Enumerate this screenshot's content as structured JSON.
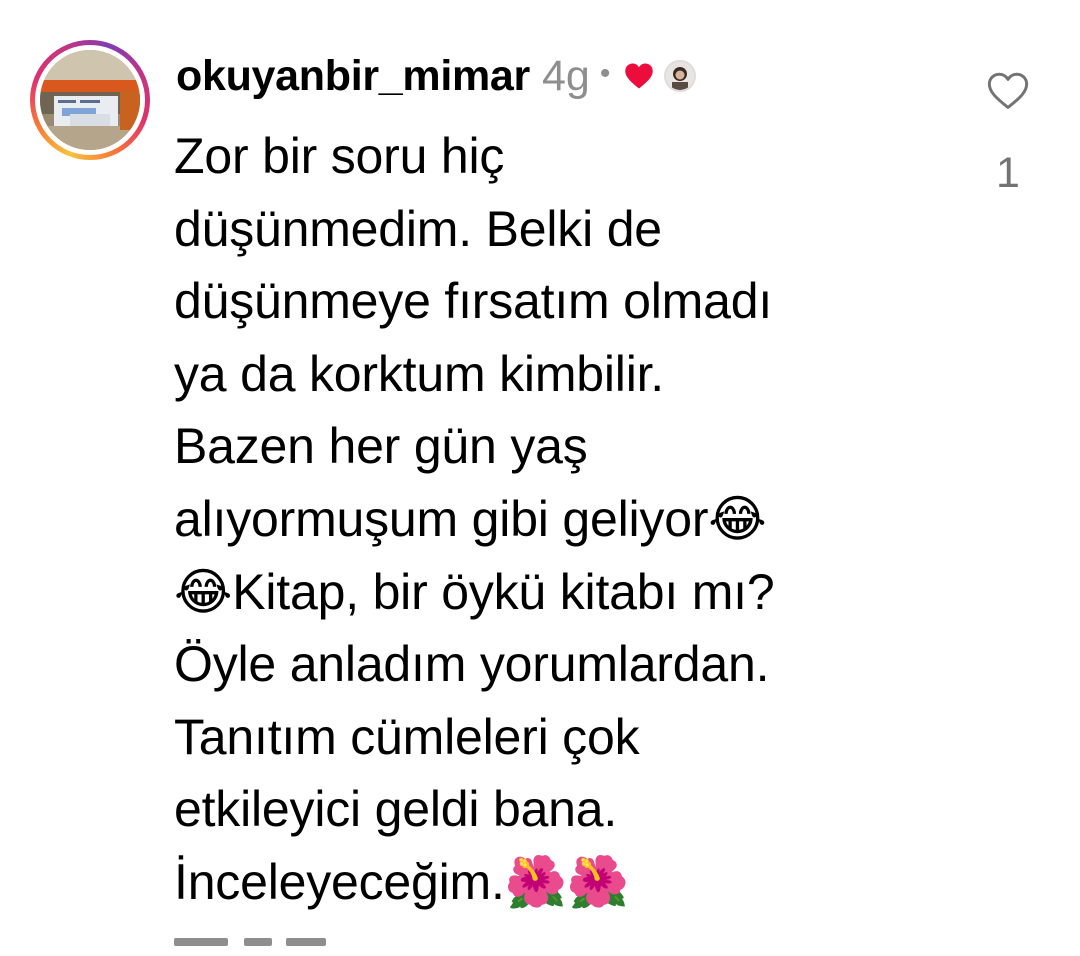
{
  "comment": {
    "username": "okuyanbir_mimar",
    "time_ago": "4g",
    "separator": "•",
    "liked_by_author": true,
    "icons": {
      "author_like": "red-heart-icon",
      "author_avatar": "author-avatar",
      "like_button": "heart-outline-icon"
    },
    "text_lines": [
      "Zor bir soru hiç",
      "düşünmedim. Belki de",
      "düşünmeye fırsatım olmadı",
      "ya da korktum kimbilir.",
      "Bazen her gün yaş",
      "alıyormuşum gibi geliyor😂",
      "😂Kitap, bir öykü kitabı mı?",
      "Öyle anladım yorumlardan.",
      "Tanıtım cümleleri çok",
      "etkileyici geldi bana.",
      "İnceleyeceğim.🌺🌺"
    ],
    "like_count": "1"
  },
  "colors": {
    "text": "#000000",
    "secondary": "#8e8e8e",
    "like_heart": "#ed0d3c"
  }
}
